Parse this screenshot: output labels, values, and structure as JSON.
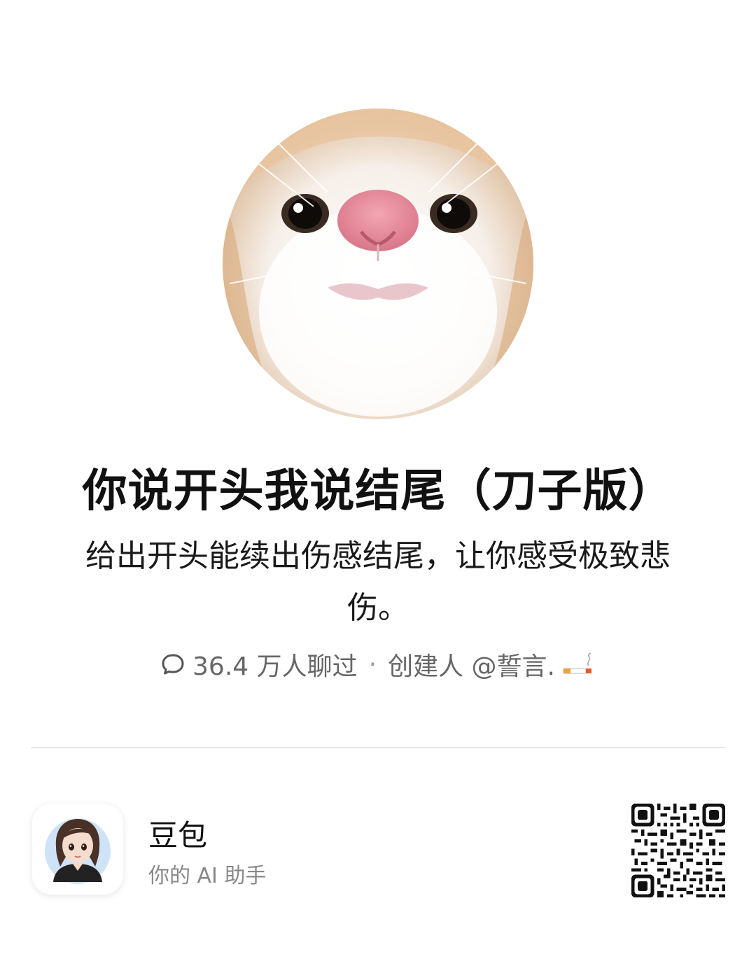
{
  "bot": {
    "avatar_icon": "cat-face-avatar",
    "title": "你说开头我说结尾（刀子版）",
    "description": "给出开头能续出伤感结尾，让你感受极致悲伤。",
    "chat_icon": "chat-bubble-icon",
    "chat_count": "36.4 万人聊过",
    "separator": "·",
    "creator": "创建人 @誓言.",
    "creator_emoji": "cigarette-icon"
  },
  "footer": {
    "app_icon": "doubao-avatar-icon",
    "app_name": "豆包",
    "app_tagline": "你的 AI 助手",
    "qr_icon": "qr-code-icon"
  },
  "colors": {
    "text_primary": "#111111",
    "text_secondary": "#666666",
    "divider": "#e8e8e8",
    "avatar_bg": "#cfe3f7"
  }
}
